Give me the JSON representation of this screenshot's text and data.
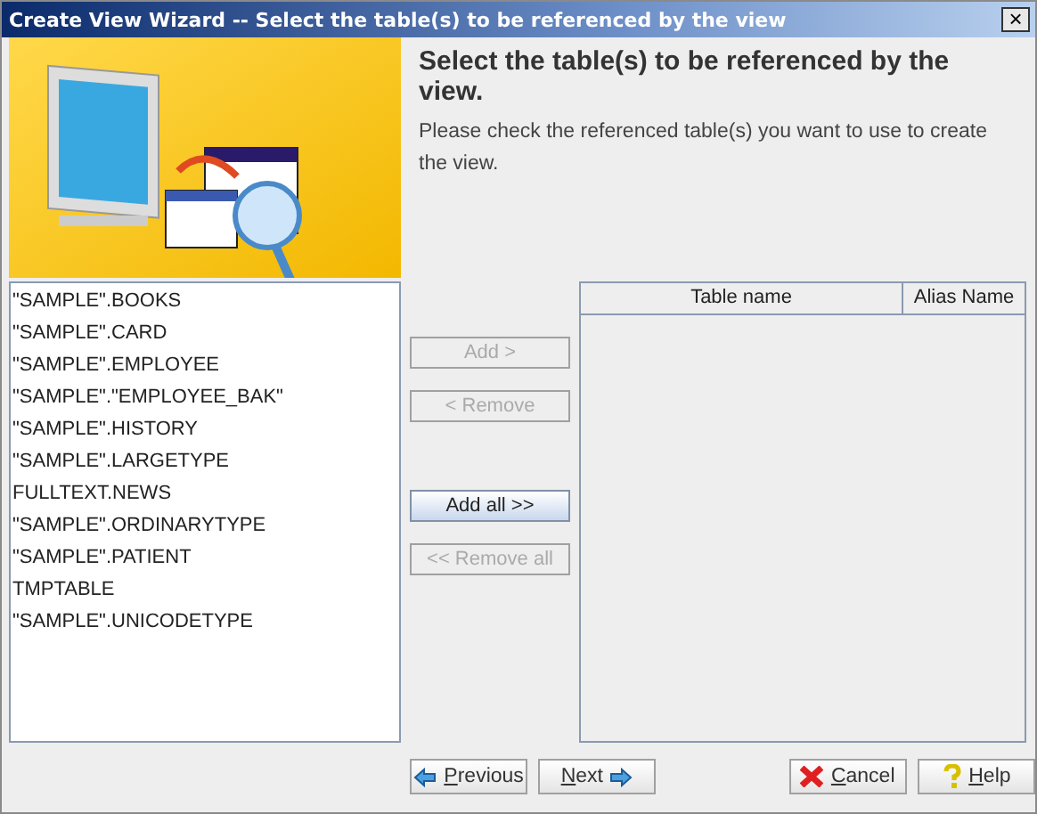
{
  "window": {
    "title": "Create View Wizard -- Select the table(s) to be referenced by the view",
    "close": "×"
  },
  "header": {
    "title": "Select the table(s) to be referenced by the view.",
    "description": "Please check the referenced table(s) you want to use to create the view."
  },
  "available_tables": [
    "\"SAMPLE\".BOOKS",
    "\"SAMPLE\".CARD",
    "\"SAMPLE\".EMPLOYEE",
    "\"SAMPLE\".\"EMPLOYEE_BAK\"",
    "\"SAMPLE\".HISTORY",
    "\"SAMPLE\".LARGETYPE",
    "FULLTEXT.NEWS",
    "\"SAMPLE\".ORDINARYTYPE",
    "\"SAMPLE\".PATIENT",
    "TMPTABLE",
    "\"SAMPLE\".UNICODETYPE"
  ],
  "transfer_buttons": [
    {
      "label": "Add >",
      "disabled": true,
      "selected": false
    },
    {
      "label": "< Remove",
      "disabled": true,
      "selected": false
    },
    {
      "label": "Add all >>",
      "disabled": false,
      "selected": true
    },
    {
      "label": "<< Remove all",
      "disabled": true,
      "selected": false
    }
  ],
  "table": {
    "columns": [
      "Table name",
      "Alias Name"
    ]
  },
  "footer_buttons": [
    {
      "kind": "previous",
      "label": "Previous"
    },
    {
      "kind": "next",
      "label": "Next"
    },
    {
      "kind": "cancel",
      "label": "Cancel"
    },
    {
      "kind": "help",
      "label": "Help"
    }
  ]
}
